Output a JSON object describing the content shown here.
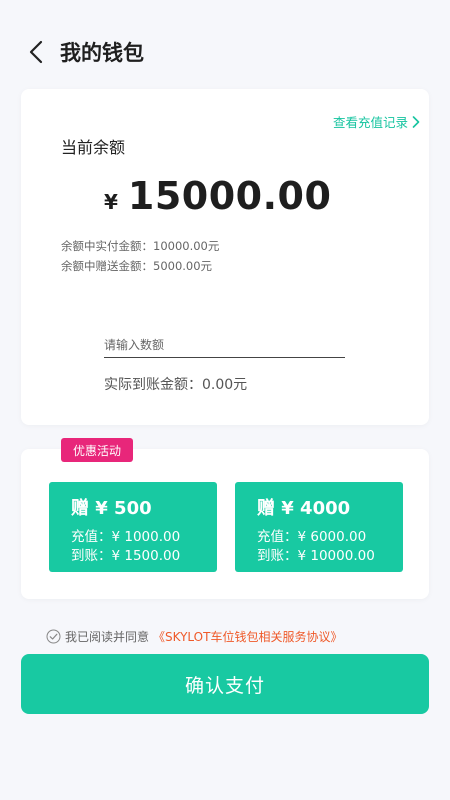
{
  "header": {
    "title": "我的钱包"
  },
  "balance_card": {
    "recharge_record_link": "查看充值记录",
    "label": "当前余额",
    "currency": "¥",
    "amount": "15000.00",
    "paid_amount": "余额中实付金额：10000.00元",
    "gift_amount": "余额中赠送金额：5000.00元",
    "input_placeholder": "请输入数额",
    "input_value": "",
    "actual_amount": "实际到账金额：0.00元"
  },
  "promotion": {
    "badge": "优惠活动",
    "offers": [
      {
        "bonus": "赠 ¥ 500",
        "recharge": "充值：¥ 1000.00",
        "receive": "到账：¥ 1500.00"
      },
      {
        "bonus": "赠 ¥ 4000",
        "recharge": "充值：¥ 6000.00",
        "receive": "到账：¥ 10000.00"
      }
    ]
  },
  "agreement": {
    "prefix": "我已阅读并同意",
    "link": "《SKYLOT车位钱包相关服务协议》"
  },
  "confirm_button": "确认支付",
  "colors": {
    "accent": "#18c9a2",
    "badge": "#e8267a",
    "link": "#ef5a2a",
    "background": "#f6f7fb"
  }
}
